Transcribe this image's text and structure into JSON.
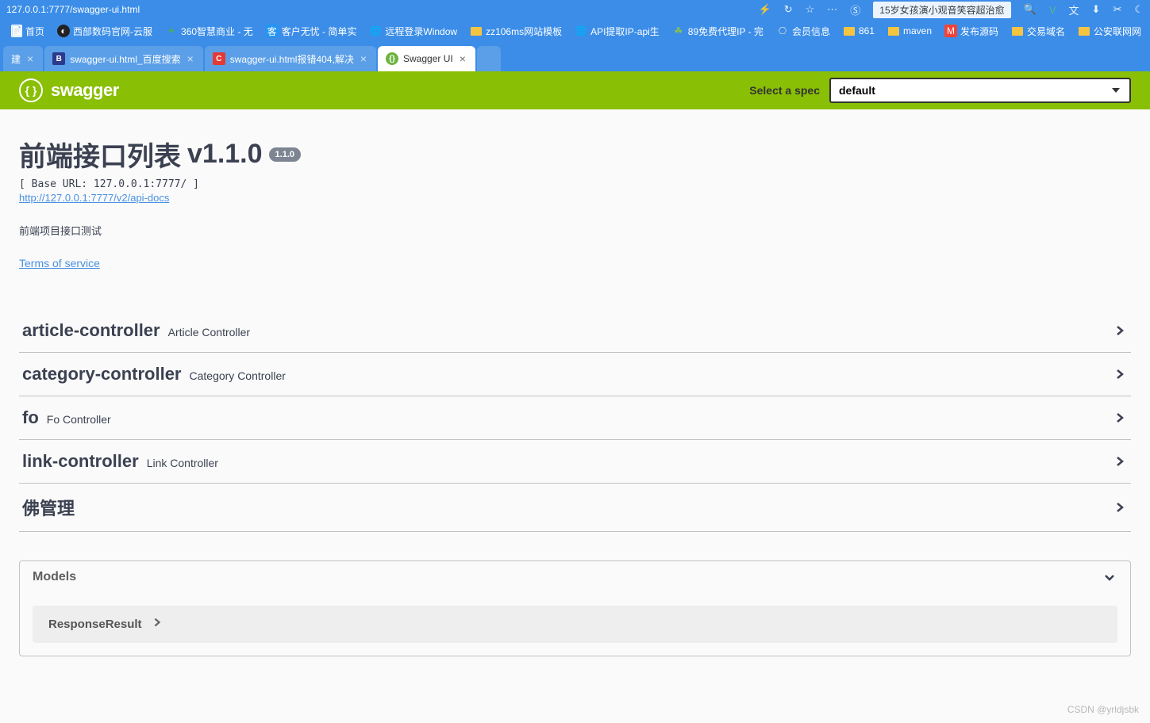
{
  "browser": {
    "url": "127.0.0.1:7777/swagger-ui.html",
    "news_text": "15岁女孩演小观音笑容超治愈",
    "bookmarks": [
      {
        "icon": "page",
        "label": "首页"
      },
      {
        "icon": "dark",
        "label": "西部数码官网-云服"
      },
      {
        "icon": "clover",
        "label": "360智慧商业 - 无"
      },
      {
        "icon": "blue",
        "label": "客户无忧 - 简单实"
      },
      {
        "icon": "globe",
        "label": "远程登录Window"
      },
      {
        "icon": "folder",
        "label": "zz106ms网站模板"
      },
      {
        "icon": "globe",
        "label": "API提取IP-api生"
      },
      {
        "icon": "leaf",
        "label": "89免费代理IP - 完"
      },
      {
        "icon": "github",
        "label": "会员信息"
      },
      {
        "icon": "folder",
        "label": "861"
      },
      {
        "icon": "folder",
        "label": "maven"
      },
      {
        "icon": "red",
        "label": "发布源码"
      },
      {
        "icon": "folder",
        "label": "交易域名"
      },
      {
        "icon": "folder",
        "label": "公安联网网"
      }
    ],
    "tabs": [
      {
        "label": "建",
        "fav": "none",
        "active": false,
        "closable": true
      },
      {
        "label": "swagger-ui.html_百度搜索",
        "fav": "baidu",
        "active": false,
        "closable": true
      },
      {
        "label": "swagger-ui.html报错404,解决",
        "fav": "c",
        "active": false,
        "closable": true
      },
      {
        "label": "Swagger UI",
        "fav": "swagger",
        "active": true,
        "closable": true
      }
    ]
  },
  "swagger": {
    "logo_text": "swagger",
    "spec_label": "Select a spec",
    "spec_value": "default"
  },
  "api": {
    "title": "前端接口列表",
    "version_inline": "v1.1.0",
    "version_badge": "1.1.0",
    "base_url": "[ Base URL: 127.0.0.1:7777/ ]",
    "docs_link": "http://127.0.0.1:7777/v2/api-docs",
    "description": "前端项目接口测试",
    "tos": "Terms of service"
  },
  "controllers": [
    {
      "name": "article-controller",
      "desc": "Article Controller"
    },
    {
      "name": "category-controller",
      "desc": "Category Controller"
    },
    {
      "name": "fo",
      "desc": "Fo Controller"
    },
    {
      "name": "link-controller",
      "desc": "Link Controller"
    },
    {
      "name": "佛管理",
      "desc": ""
    }
  ],
  "models": {
    "title": "Models",
    "items": [
      "ResponseResult"
    ]
  },
  "watermark": "CSDN @yrldjsbk"
}
